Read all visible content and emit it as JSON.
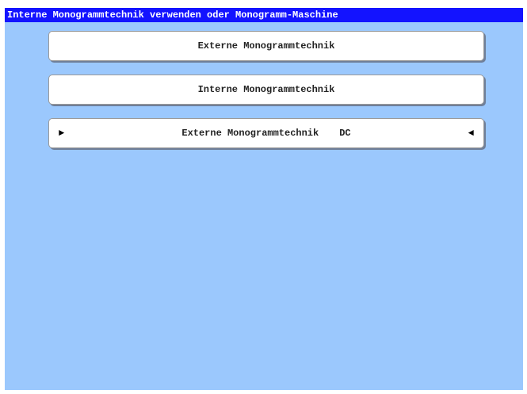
{
  "title": "Interne Monogrammtechnik verwenden oder Monogramm-Maschine",
  "options": [
    {
      "label": "Externe Monogrammtechnik",
      "suffix": "",
      "selected": false
    },
    {
      "label": "Interne Monogrammtechnik",
      "suffix": "",
      "selected": false
    },
    {
      "label": "Externe Monogrammtechnik",
      "suffix": "DC",
      "selected": true
    }
  ],
  "markers": {
    "left": "►",
    "right": "◄"
  },
  "colors": {
    "background": "#9bc8fd",
    "title_bar": "#1313ff",
    "title_text": "#ffffff",
    "button": "#ffffff"
  }
}
